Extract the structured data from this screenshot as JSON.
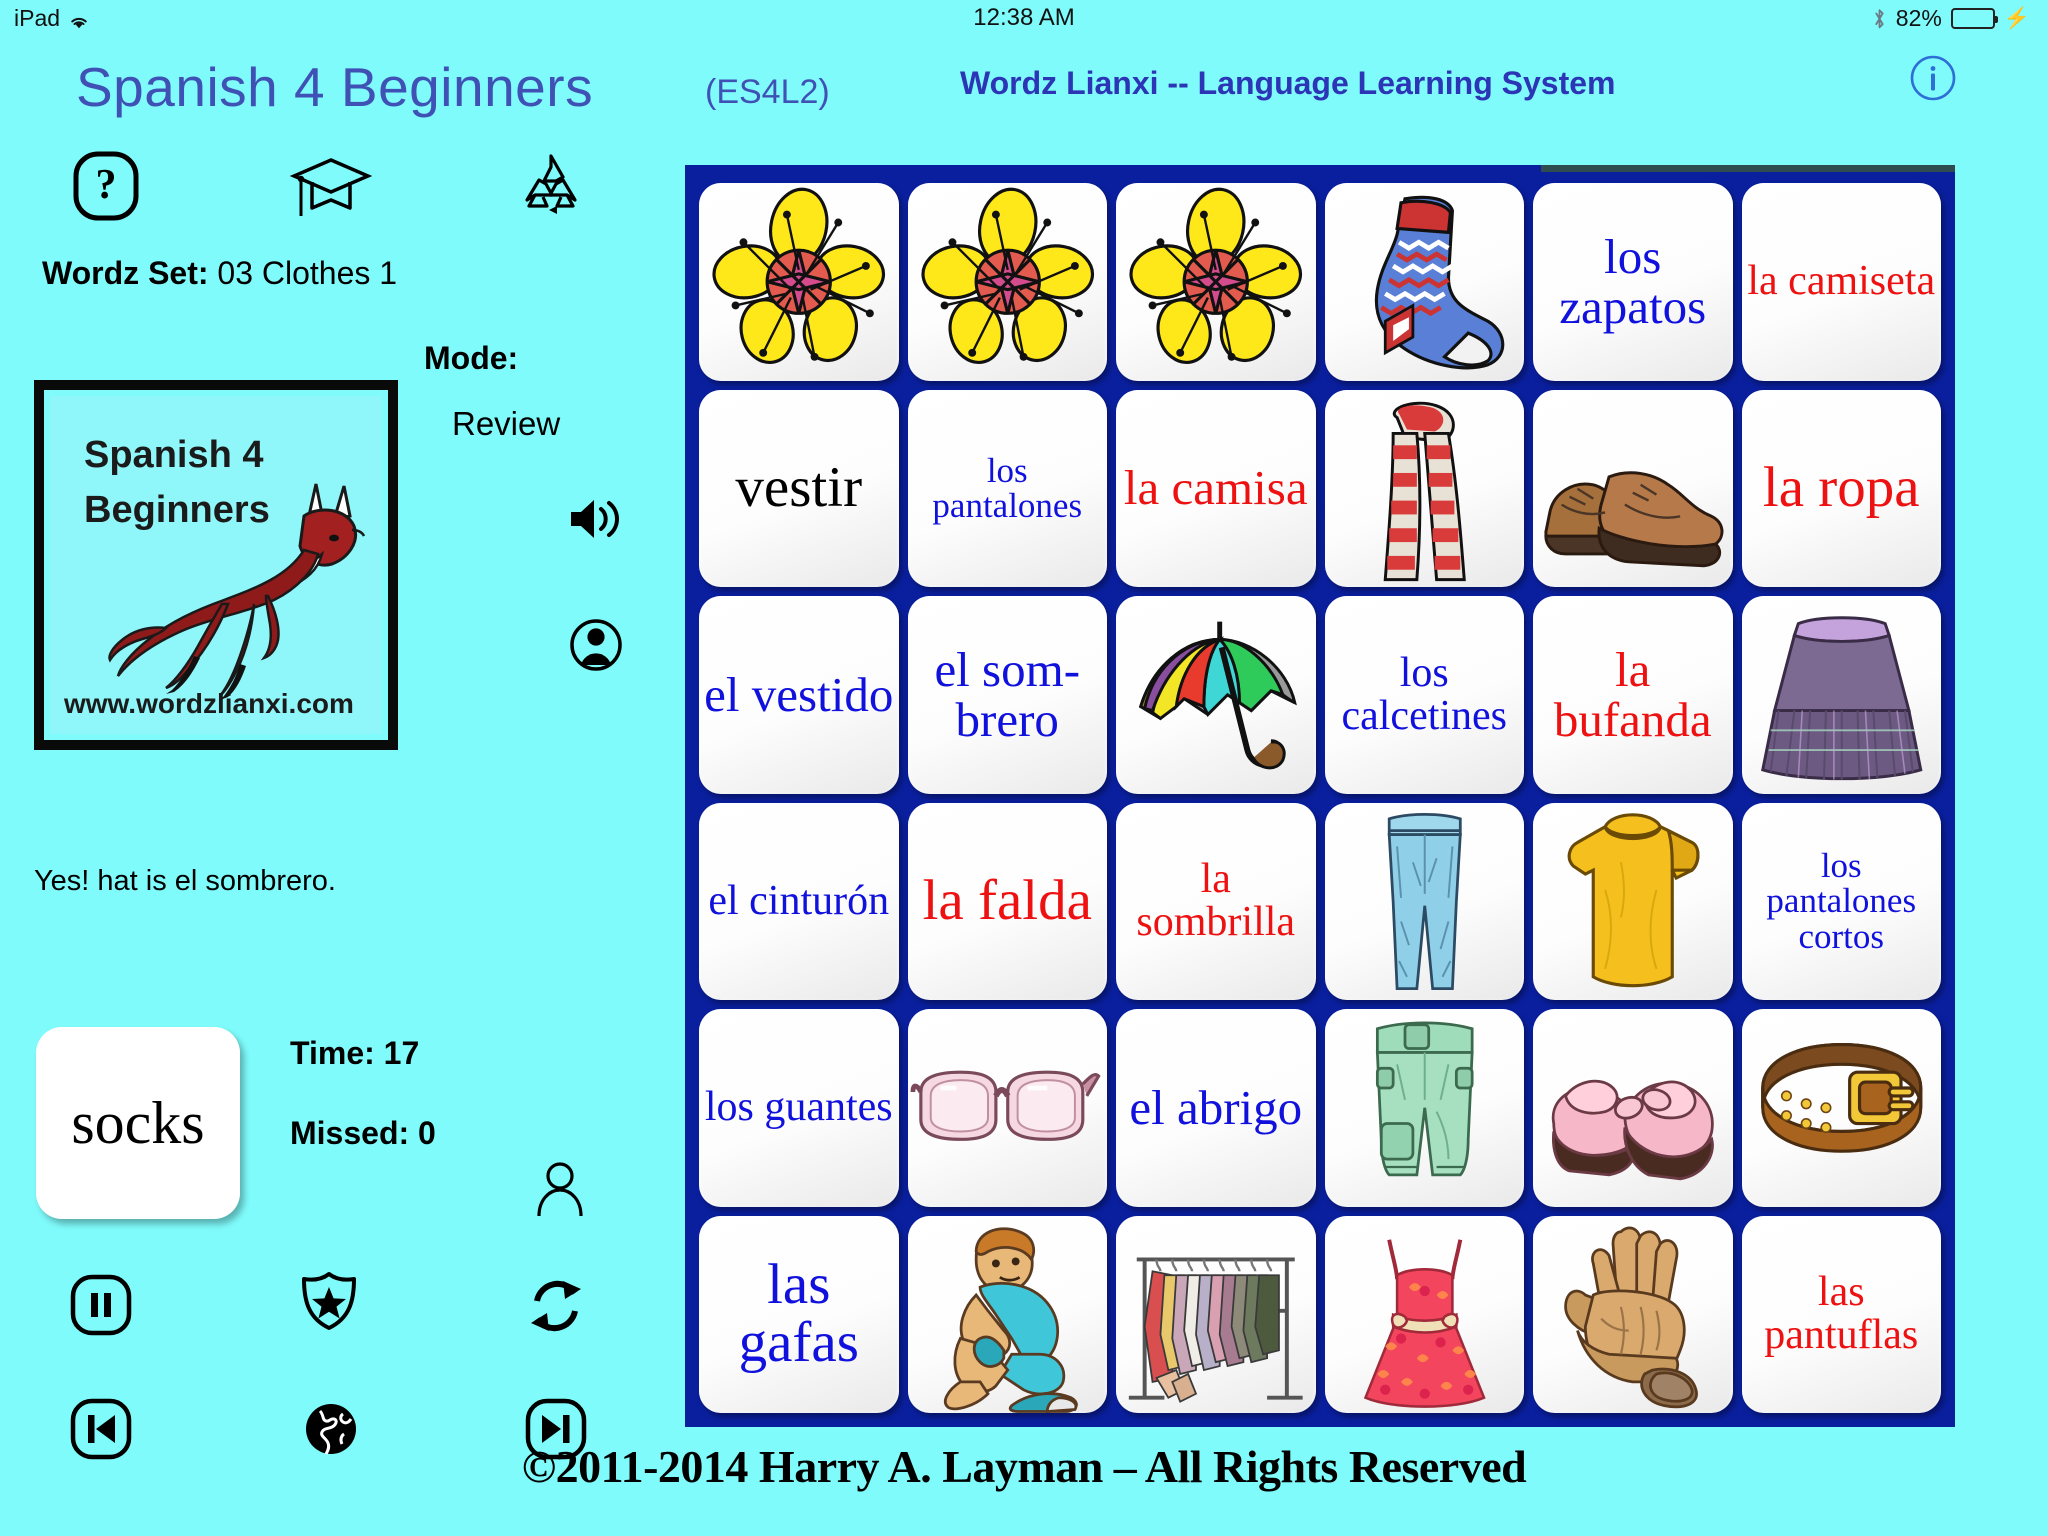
{
  "statusbar": {
    "device": "iPad",
    "wifi_icon": "wifi-icon",
    "time": "12:38 AM",
    "bluetooth_icon": "bluetooth-icon",
    "battery_percent": "82%",
    "battery_level": 82,
    "charging_icon": "lightning-bolt-icon",
    "battery_color": "#4CD964"
  },
  "header": {
    "app_title": "Spanish 4 Beginners",
    "app_code": "(ES4L2)",
    "system_title": "Wordz Lianxi -- Language Learning System",
    "info_icon": "info-circle-icon",
    "title_color": "#3F51B5",
    "system_title_color": "#2B35B5"
  },
  "sidebar": {
    "icons": [
      {
        "name": "help-icon",
        "label": "Help"
      },
      {
        "name": "graduation-cap-icon",
        "label": "Learn"
      },
      {
        "name": "recycle-icon",
        "label": "Recycle"
      }
    ],
    "wordz_set_label": "Wordz Set:",
    "wordz_set_value": "03 Clothes 1",
    "mode_label": "Mode:",
    "mode_value": "Review",
    "speaker_icon": "speaker-icon",
    "person_icon": "person-circle-icon",
    "person_outline_icon": "person-outline-icon",
    "logo": {
      "line1": "Spanish 4",
      "line2": "Beginners",
      "url": "www.wordzlianxi.com",
      "animal_icon": "leaping-fox-icon",
      "background": "#8FF7F9",
      "border_color": "#0a0a0a"
    },
    "feedback": "Yes! hat is el sombrero.",
    "prompt_word": "socks",
    "time_stat": "Time: 17",
    "missed_stat": "Missed: 0",
    "controls": [
      {
        "name": "pause-button",
        "icon": "pause-icon"
      },
      {
        "name": "award-button",
        "icon": "shield-star-icon"
      },
      {
        "name": "refresh-button",
        "icon": "refresh-icon"
      },
      {
        "name": "previous-button",
        "icon": "skip-back-icon"
      },
      {
        "name": "globe-button",
        "icon": "globe-icon"
      },
      {
        "name": "next-button",
        "icon": "skip-forward-icon"
      }
    ]
  },
  "board": {
    "background_color": "#0A1F9E",
    "columns": 6,
    "rows": 6,
    "cells": [
      {
        "id": "r1c1",
        "type": "image",
        "pic": "flower",
        "alt": "yellow flower"
      },
      {
        "id": "r1c2",
        "type": "image",
        "pic": "flower",
        "alt": "yellow flower"
      },
      {
        "id": "r1c3",
        "type": "image",
        "pic": "flower",
        "alt": "yellow flower"
      },
      {
        "id": "r1c4",
        "type": "image",
        "pic": "sock",
        "alt": "striped sock"
      },
      {
        "id": "r1c5",
        "type": "word",
        "text": "los zapatos",
        "color": "blue",
        "size": "lg"
      },
      {
        "id": "r1c6",
        "type": "word",
        "text": "la camiseta",
        "color": "red",
        "size": "md"
      },
      {
        "id": "r2c1",
        "type": "word",
        "text": "vestir",
        "color": "black",
        "size": "xl"
      },
      {
        "id": "r2c2",
        "type": "word",
        "text": "los pantalones",
        "color": "blue",
        "size": "sm"
      },
      {
        "id": "r2c3",
        "type": "word",
        "text": "la camisa",
        "color": "red",
        "size": "lg"
      },
      {
        "id": "r2c4",
        "type": "image",
        "pic": "scarf",
        "alt": "red striped scarf"
      },
      {
        "id": "r2c5",
        "type": "image",
        "pic": "shoes",
        "alt": "brown dress shoes"
      },
      {
        "id": "r2c6",
        "type": "word",
        "text": "la ropa",
        "color": "red",
        "size": "xl"
      },
      {
        "id": "r3c1",
        "type": "word",
        "text": "el vestido",
        "color": "blue",
        "size": "lg"
      },
      {
        "id": "r3c2",
        "type": "word",
        "text": "el som- brero",
        "color": "blue",
        "size": "lg"
      },
      {
        "id": "r3c3",
        "type": "image",
        "pic": "umbrella",
        "alt": "rainbow umbrella"
      },
      {
        "id": "r3c4",
        "type": "word",
        "text": "los calcetines",
        "color": "blue",
        "size": "md"
      },
      {
        "id": "r3c5",
        "type": "word",
        "text": "la bufanda",
        "color": "red",
        "size": "lg"
      },
      {
        "id": "r3c6",
        "type": "image",
        "pic": "skirt",
        "alt": "purple pleated skirt"
      },
      {
        "id": "r4c1",
        "type": "word",
        "text": "el cinturón",
        "color": "blue",
        "size": "md"
      },
      {
        "id": "r4c2",
        "type": "word",
        "text": "la falda",
        "color": "red",
        "size": "xl"
      },
      {
        "id": "r4c3",
        "type": "word",
        "text": "la sombrilla",
        "color": "red",
        "size": "md"
      },
      {
        "id": "r4c4",
        "type": "image",
        "pic": "pants",
        "alt": "light blue trousers"
      },
      {
        "id": "r4c5",
        "type": "image",
        "pic": "tshirt",
        "alt": "yellow t-shirt"
      },
      {
        "id": "r4c6",
        "type": "word",
        "text": "los pantalones cortos",
        "color": "blue",
        "size": "sm"
      },
      {
        "id": "r5c1",
        "type": "word",
        "text": "los guantes",
        "color": "blue",
        "size": "md"
      },
      {
        "id": "r5c2",
        "type": "image",
        "pic": "glasses",
        "alt": "pink eyeglasses"
      },
      {
        "id": "r5c3",
        "type": "word",
        "text": "el abrigo",
        "color": "blue",
        "size": "lg"
      },
      {
        "id": "r5c4",
        "type": "image",
        "pic": "shorts",
        "alt": "green cargo shorts"
      },
      {
        "id": "r5c5",
        "type": "image",
        "pic": "slippers",
        "alt": "pink fuzzy slippers"
      },
      {
        "id": "r5c6",
        "type": "image",
        "pic": "belt",
        "alt": "brown leather belt"
      },
      {
        "id": "r6c1",
        "type": "word",
        "text": "las gafas",
        "color": "blue",
        "size": "xl"
      },
      {
        "id": "r6c2",
        "type": "image",
        "pic": "boy-sock",
        "alt": "boy putting on socks"
      },
      {
        "id": "r6c3",
        "type": "image",
        "pic": "rack",
        "alt": "clothing rack"
      },
      {
        "id": "r6c4",
        "type": "image",
        "pic": "dress",
        "alt": "red floral dress"
      },
      {
        "id": "r6c5",
        "type": "image",
        "pic": "gloves",
        "alt": "leather gloves"
      },
      {
        "id": "r6c6",
        "type": "word",
        "text": "las pantuflas",
        "color": "red",
        "size": "md"
      }
    ]
  },
  "footer": {
    "copyright": "©2011-2014 Harry A. Layman – All Rights Reserved"
  }
}
